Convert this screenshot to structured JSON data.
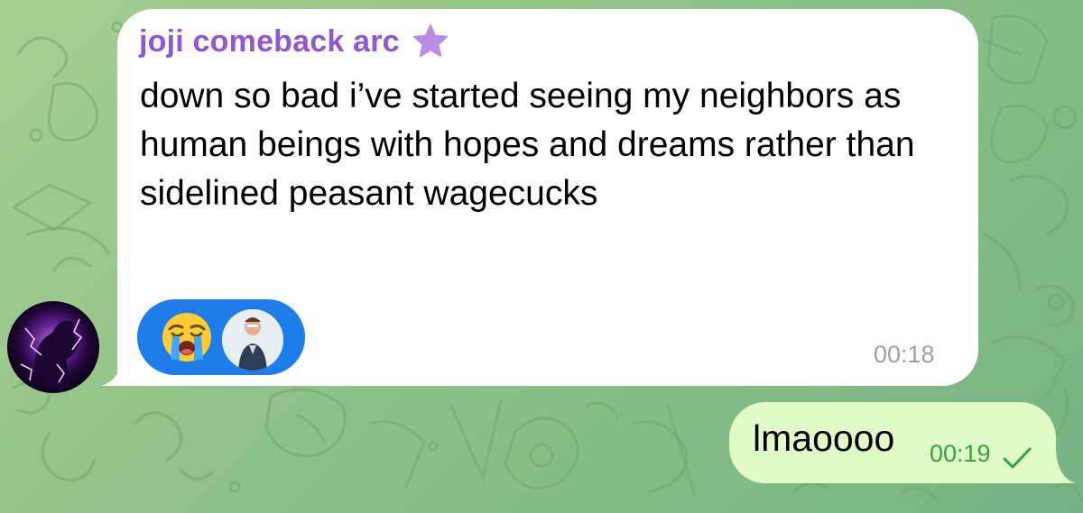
{
  "chat": {
    "incoming": {
      "sender_name": "joji comeback arc",
      "badge_icon": "star-icon",
      "text": "down so bad i’ve started seeing my neighbors as human beings with hopes and dreams rather than sidelined peasant wagecucks",
      "reactions": [
        {
          "emoji": "😭",
          "icon": "loudly-crying-face-icon"
        },
        {
          "icon": "reactor-avatar"
        }
      ],
      "time": "00:18"
    },
    "outgoing": {
      "text": "lmaoooo",
      "time": "00:19",
      "status_icon": "single-check-icon"
    }
  },
  "colors": {
    "sender_name": "#8f57d0",
    "reaction_pill": "#1e7de8",
    "outgoing_bubble": "#e0fbc8",
    "outgoing_time": "#37a33d",
    "incoming_time": "#9aa0a6",
    "wallpaper": "#8fc189"
  }
}
